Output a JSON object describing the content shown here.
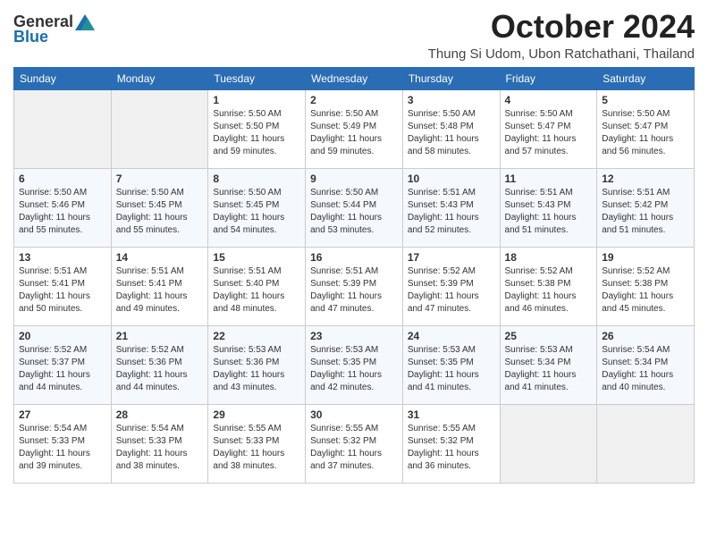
{
  "logo": {
    "general": "General",
    "blue": "Blue"
  },
  "title": "October 2024",
  "subtitle": "Thung Si Udom, Ubon Ratchathani, Thailand",
  "headers": [
    "Sunday",
    "Monday",
    "Tuesday",
    "Wednesday",
    "Thursday",
    "Friday",
    "Saturday"
  ],
  "weeks": [
    [
      {
        "day": "",
        "info": ""
      },
      {
        "day": "",
        "info": ""
      },
      {
        "day": "1",
        "info": "Sunrise: 5:50 AM\nSunset: 5:50 PM\nDaylight: 11 hours and 59 minutes."
      },
      {
        "day": "2",
        "info": "Sunrise: 5:50 AM\nSunset: 5:49 PM\nDaylight: 11 hours and 59 minutes."
      },
      {
        "day": "3",
        "info": "Sunrise: 5:50 AM\nSunset: 5:48 PM\nDaylight: 11 hours and 58 minutes."
      },
      {
        "day": "4",
        "info": "Sunrise: 5:50 AM\nSunset: 5:47 PM\nDaylight: 11 hours and 57 minutes."
      },
      {
        "day": "5",
        "info": "Sunrise: 5:50 AM\nSunset: 5:47 PM\nDaylight: 11 hours and 56 minutes."
      }
    ],
    [
      {
        "day": "6",
        "info": "Sunrise: 5:50 AM\nSunset: 5:46 PM\nDaylight: 11 hours and 55 minutes."
      },
      {
        "day": "7",
        "info": "Sunrise: 5:50 AM\nSunset: 5:45 PM\nDaylight: 11 hours and 55 minutes."
      },
      {
        "day": "8",
        "info": "Sunrise: 5:50 AM\nSunset: 5:45 PM\nDaylight: 11 hours and 54 minutes."
      },
      {
        "day": "9",
        "info": "Sunrise: 5:50 AM\nSunset: 5:44 PM\nDaylight: 11 hours and 53 minutes."
      },
      {
        "day": "10",
        "info": "Sunrise: 5:51 AM\nSunset: 5:43 PM\nDaylight: 11 hours and 52 minutes."
      },
      {
        "day": "11",
        "info": "Sunrise: 5:51 AM\nSunset: 5:43 PM\nDaylight: 11 hours and 51 minutes."
      },
      {
        "day": "12",
        "info": "Sunrise: 5:51 AM\nSunset: 5:42 PM\nDaylight: 11 hours and 51 minutes."
      }
    ],
    [
      {
        "day": "13",
        "info": "Sunrise: 5:51 AM\nSunset: 5:41 PM\nDaylight: 11 hours and 50 minutes."
      },
      {
        "day": "14",
        "info": "Sunrise: 5:51 AM\nSunset: 5:41 PM\nDaylight: 11 hours and 49 minutes."
      },
      {
        "day": "15",
        "info": "Sunrise: 5:51 AM\nSunset: 5:40 PM\nDaylight: 11 hours and 48 minutes."
      },
      {
        "day": "16",
        "info": "Sunrise: 5:51 AM\nSunset: 5:39 PM\nDaylight: 11 hours and 47 minutes."
      },
      {
        "day": "17",
        "info": "Sunrise: 5:52 AM\nSunset: 5:39 PM\nDaylight: 11 hours and 47 minutes."
      },
      {
        "day": "18",
        "info": "Sunrise: 5:52 AM\nSunset: 5:38 PM\nDaylight: 11 hours and 46 minutes."
      },
      {
        "day": "19",
        "info": "Sunrise: 5:52 AM\nSunset: 5:38 PM\nDaylight: 11 hours and 45 minutes."
      }
    ],
    [
      {
        "day": "20",
        "info": "Sunrise: 5:52 AM\nSunset: 5:37 PM\nDaylight: 11 hours and 44 minutes."
      },
      {
        "day": "21",
        "info": "Sunrise: 5:52 AM\nSunset: 5:36 PM\nDaylight: 11 hours and 44 minutes."
      },
      {
        "day": "22",
        "info": "Sunrise: 5:53 AM\nSunset: 5:36 PM\nDaylight: 11 hours and 43 minutes."
      },
      {
        "day": "23",
        "info": "Sunrise: 5:53 AM\nSunset: 5:35 PM\nDaylight: 11 hours and 42 minutes."
      },
      {
        "day": "24",
        "info": "Sunrise: 5:53 AM\nSunset: 5:35 PM\nDaylight: 11 hours and 41 minutes."
      },
      {
        "day": "25",
        "info": "Sunrise: 5:53 AM\nSunset: 5:34 PM\nDaylight: 11 hours and 41 minutes."
      },
      {
        "day": "26",
        "info": "Sunrise: 5:54 AM\nSunset: 5:34 PM\nDaylight: 11 hours and 40 minutes."
      }
    ],
    [
      {
        "day": "27",
        "info": "Sunrise: 5:54 AM\nSunset: 5:33 PM\nDaylight: 11 hours and 39 minutes."
      },
      {
        "day": "28",
        "info": "Sunrise: 5:54 AM\nSunset: 5:33 PM\nDaylight: 11 hours and 38 minutes."
      },
      {
        "day": "29",
        "info": "Sunrise: 5:55 AM\nSunset: 5:33 PM\nDaylight: 11 hours and 38 minutes."
      },
      {
        "day": "30",
        "info": "Sunrise: 5:55 AM\nSunset: 5:32 PM\nDaylight: 11 hours and 37 minutes."
      },
      {
        "day": "31",
        "info": "Sunrise: 5:55 AM\nSunset: 5:32 PM\nDaylight: 11 hours and 36 minutes."
      },
      {
        "day": "",
        "info": ""
      },
      {
        "day": "",
        "info": ""
      }
    ]
  ]
}
